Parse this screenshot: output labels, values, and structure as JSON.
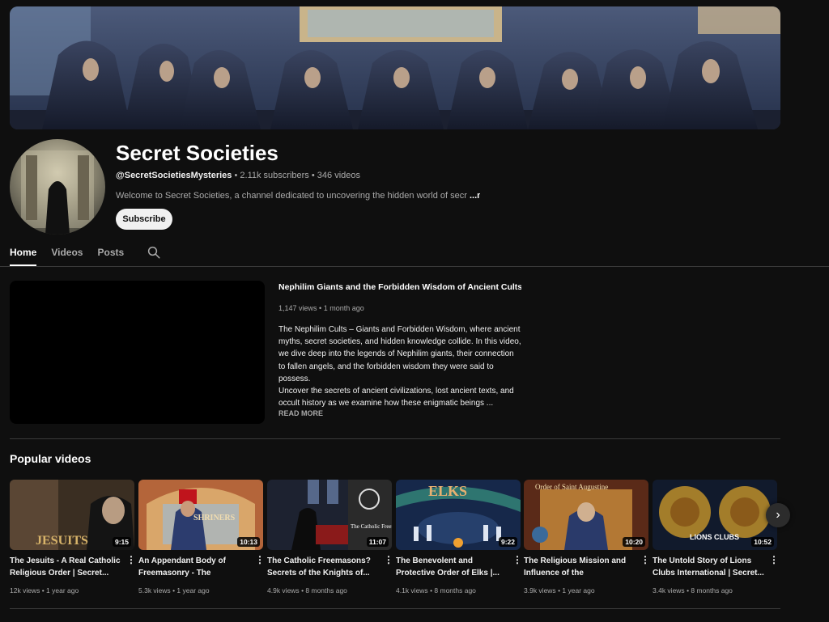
{
  "channel": {
    "title": "Secret Societies",
    "handle": "@SecretSocietiesMysteries",
    "subscribers": "2.11k subscribers",
    "videos_count": "346 videos",
    "description": "Welcome to Secret Societies, a channel dedicated to uncovering the hidden world of secr",
    "more_label": "...more",
    "subscribe_label": "Subscribe"
  },
  "tabs": [
    {
      "label": "Home",
      "active": true
    },
    {
      "label": "Videos",
      "active": false
    },
    {
      "label": "Posts",
      "active": false
    }
  ],
  "search_icon": "search-icon",
  "featured": {
    "title": "Nephilim Giants and the Forbidden Wisdom of Ancient Cults | ...",
    "views": "1,147 views",
    "age": "1 month ago",
    "description_lines": [
      "The Nephilim Cults – Giants and Forbidden Wisdom, where ancient myths, secret societies, and hidden knowledge collide. In this video, we dive deep into the legends of Nephilim giants, their connection to fallen angels, and the forbidden wisdom they were said to possess.",
      "Uncover the secrets of ancient civilizations, lost ancient texts, and occult history as we examine how these enigmatic beings ..."
    ],
    "read_more": "READ MORE"
  },
  "popular": {
    "title": "Popular videos",
    "next_icon": "chevron-right-icon",
    "videos": [
      {
        "title": "The Jesuits - A Real Catholic Religious Order | Secret...",
        "views": "12k views",
        "age": "1 year ago",
        "duration": "9:15",
        "thumb_text": "JESUITS"
      },
      {
        "title": "An Appendant Body of Freemasonry - The Shriners...",
        "views": "5.3k views",
        "age": "1 year ago",
        "duration": "10:13",
        "thumb_text": "SHRINERS"
      },
      {
        "title": "The Catholic Freemasons? Secrets of the Knights of...",
        "views": "4.9k views",
        "age": "8 months ago",
        "duration": "11:07",
        "thumb_text": "The Catholic Freemasons?"
      },
      {
        "title": "The Benevolent and Protective Order of Elks |...",
        "views": "4.1k views",
        "age": "8 months ago",
        "duration": "9:22",
        "thumb_text": "ELKS"
      },
      {
        "title": "The Religious Mission and Influence of the Augustinian...",
        "views": "3.9k views",
        "age": "1 year ago",
        "duration": "10:20",
        "thumb_text": "Order of Saint Augustine"
      },
      {
        "title": "The Untold Story of Lions Clubs International | Secret...",
        "views": "3.4k views",
        "age": "8 months ago",
        "duration": "10:52",
        "thumb_text": "LIONS CLUBS"
      }
    ]
  },
  "colors": {
    "background": "#0f0f0f",
    "text": "#f1f1f1",
    "muted": "#aaaaaa"
  }
}
